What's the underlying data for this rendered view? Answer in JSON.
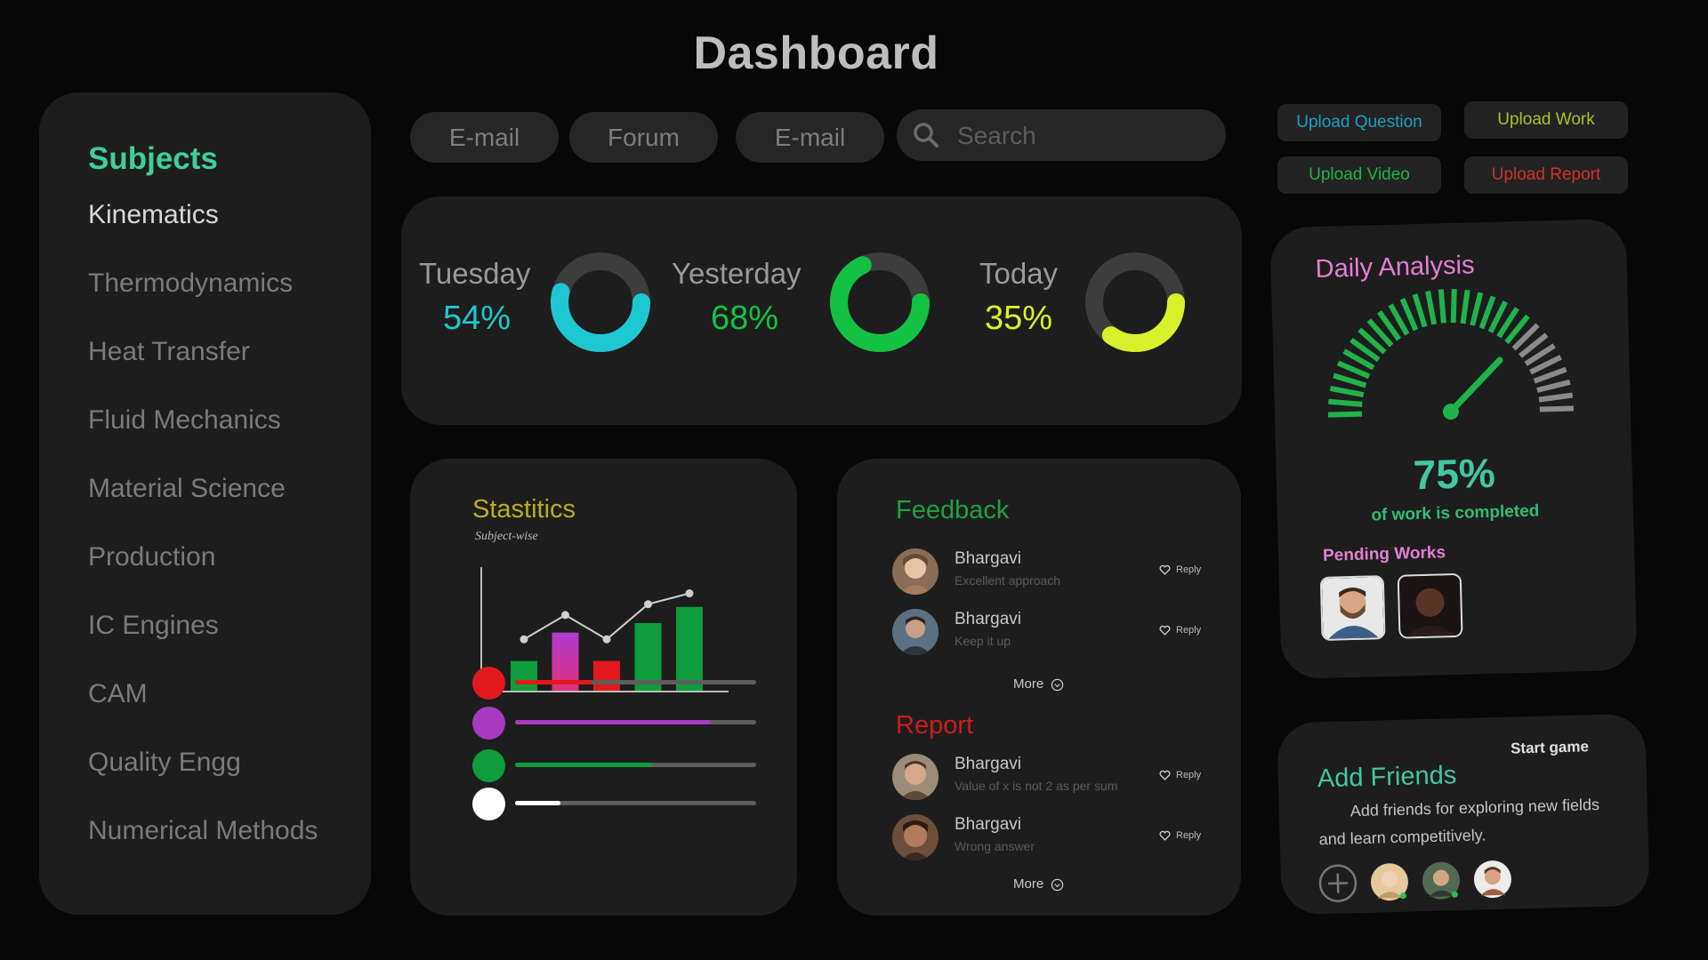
{
  "page": {
    "title": "Dashboard"
  },
  "sidebar": {
    "heading": "Subjects",
    "items": [
      {
        "label": "Kinematics",
        "active": true
      },
      {
        "label": "Thermodynamics"
      },
      {
        "label": "Heat Transfer"
      },
      {
        "label": "Fluid Mechanics"
      },
      {
        "label": "Material Science"
      },
      {
        "label": "Production"
      },
      {
        "label": "IC Engines"
      },
      {
        "label": "CAM"
      },
      {
        "label": "Quality Engg"
      },
      {
        "label": "Numerical Methods"
      }
    ]
  },
  "nav": {
    "pills": [
      "E-mail",
      "Forum",
      "E-mail"
    ],
    "search_placeholder": "Search"
  },
  "uploads": [
    {
      "label": "Upload Question",
      "color": "#1e9fc4"
    },
    {
      "label": "Upload Work",
      "color": "#a9c22a"
    },
    {
      "label": "Upload Video",
      "color": "#1fb34a"
    },
    {
      "label": "Upload Report",
      "color": "#d0302c"
    }
  ],
  "progress": [
    {
      "day": "Tuesday",
      "percent_label": "54%",
      "value": 54,
      "color": "#1ec8d2"
    },
    {
      "day": "Yesterday",
      "percent_label": "68%",
      "value": 68,
      "color": "#13c243"
    },
    {
      "day": "Today",
      "percent_label": "35%",
      "value": 35,
      "color": "#d8f12a"
    }
  ],
  "statistics": {
    "title": "Stastitics",
    "subtitle": "Subject-wise",
    "chart_data": {
      "type": "bar",
      "bars": [
        {
          "value": 22,
          "color": "green"
        },
        {
          "value": 43,
          "color": "purple-gradient"
        },
        {
          "value": 22,
          "color": "red"
        },
        {
          "value": 50,
          "color": "green"
        },
        {
          "value": 62,
          "color": "green"
        }
      ],
      "line": [
        38,
        56,
        38,
        64,
        72
      ]
    },
    "progress_bars": [
      {
        "color": "#e0191c",
        "fraction": 0.32
      },
      {
        "color": "#a83ac1",
        "fraction": 0.81
      },
      {
        "color": "#0f9c3c",
        "fraction": 0.57
      },
      {
        "color": "#ffffff",
        "fraction": 0.19
      }
    ]
  },
  "feedback": {
    "title": "Feedback",
    "items": [
      {
        "name": "Bhargavi",
        "message": "Excellent approach",
        "reply": "Reply"
      },
      {
        "name": "Bhargavi",
        "message": "Keep it up",
        "reply": "Reply"
      }
    ],
    "more": "More"
  },
  "report": {
    "title": "Report",
    "items": [
      {
        "name": "Bhargavi",
        "message": "Value of x is not 2 as per sum",
        "reply": "Reply"
      },
      {
        "name": "Bhargavi",
        "message": "Wrong answer",
        "reply": "Reply"
      }
    ],
    "more": "More"
  },
  "daily": {
    "title": "Daily Analysis",
    "percent_label": "75%",
    "value": 75,
    "caption": "of work is completed",
    "pending_title": "Pending Works"
  },
  "friends": {
    "start_game": "Start game",
    "title": "Add Friends",
    "description": "Add friends for exploring new fields and learn competitively."
  }
}
